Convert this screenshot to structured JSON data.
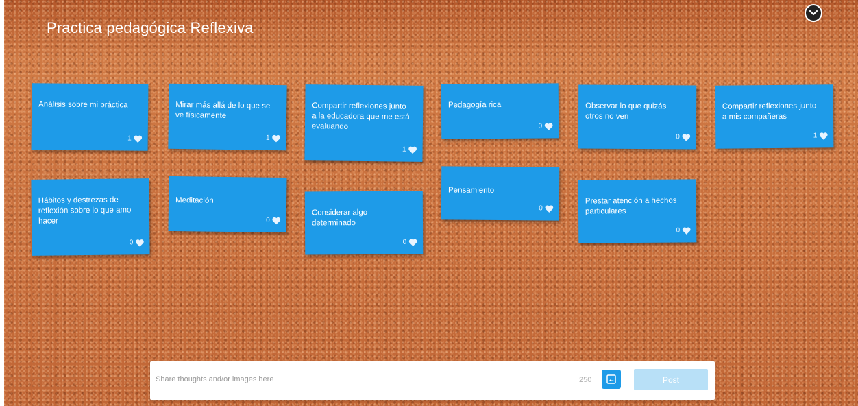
{
  "board": {
    "title": "Practica pedagógica Reflexiva",
    "collapse_icon": "chevron-down-circle-icon"
  },
  "notes": [
    {
      "text": "Análisis sobre mi práctica",
      "likes": "1"
    },
    {
      "text": "Mirar más allá de lo que se ve físicamente",
      "likes": "1"
    },
    {
      "text": "Compartir reflexiones junto a la educadora que me está evaluando",
      "likes": "1"
    },
    {
      "text": "Pedagogía rica",
      "likes": "0"
    },
    {
      "text": "Observar lo que quizás otros no ven",
      "likes": "0"
    },
    {
      "text": "Compartir reflexiones junto a mis compañeras",
      "likes": "1"
    },
    {
      "text": "Hábitos y destrezas de reflexión sobre lo que amo hacer",
      "likes": "0"
    },
    {
      "text": "Meditación",
      "likes": "0"
    },
    {
      "text": "Considerar algo determinado",
      "likes": "0"
    },
    {
      "text": "Pensamiento",
      "likes": "0"
    },
    {
      "text": "Prestar atención a hechos particulares",
      "likes": "0"
    }
  ],
  "composer": {
    "placeholder": "Share thoughts and/or images here",
    "char_limit": "250",
    "image_icon": "image-icon",
    "post_label": "Post"
  },
  "colors": {
    "note": "#1e9be8",
    "post_disabled": "#b8e0f7",
    "board": "#c46a3a"
  }
}
